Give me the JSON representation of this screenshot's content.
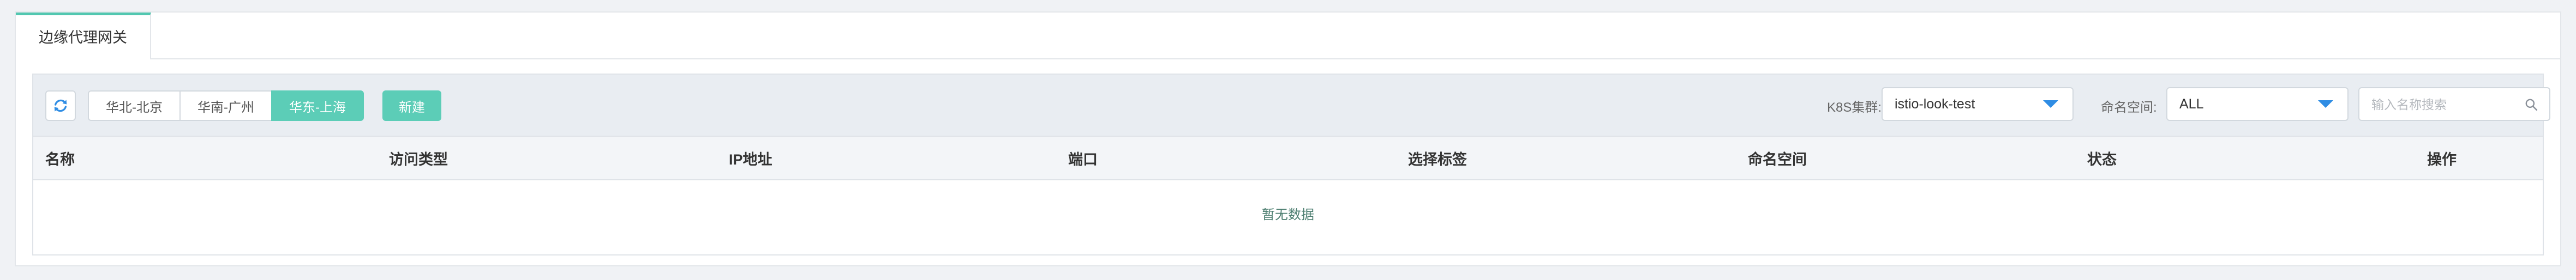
{
  "tabs": [
    {
      "label": "边缘代理网关",
      "active": true
    }
  ],
  "toolbar": {
    "regions": [
      {
        "label": "华北-北京",
        "active": false
      },
      {
        "label": "华南-广州",
        "active": false
      },
      {
        "label": "华东-上海",
        "active": true
      }
    ],
    "new_label": "新建",
    "cluster_label": "K8S集群:",
    "cluster_value": "istio-look-test",
    "namespace_label": "命名空间:",
    "namespace_value": "ALL",
    "search_placeholder": "输入名称搜索"
  },
  "table": {
    "columns": [
      "名称",
      "访问类型",
      "IP地址",
      "端口",
      "选择标签",
      "命名空间",
      "状态",
      "操作"
    ],
    "rows": [],
    "empty_text": "暂无数据"
  },
  "colors": {
    "accent": "#5ccdb7",
    "caret": "#2f8de4",
    "refresh_icon": "#2f8de4"
  },
  "icons": {
    "refresh": "refresh-icon",
    "search": "search-icon",
    "dropdown": "chevron-down-icon"
  }
}
